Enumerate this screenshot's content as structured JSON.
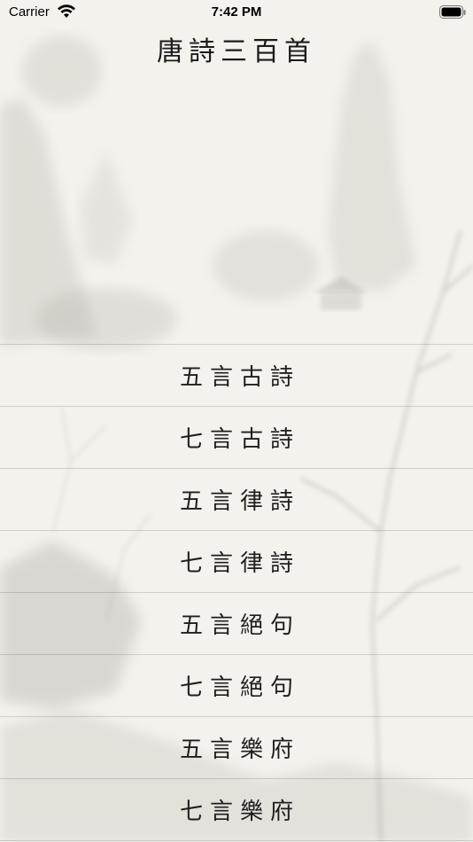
{
  "status_bar": {
    "carrier": "Carrier",
    "time": "7:42 PM",
    "wifi_icon": "wifi-icon",
    "battery_icon": "battery-icon"
  },
  "header": {
    "title": "唐詩三百首"
  },
  "menu": {
    "items": [
      {
        "label": "五言古詩"
      },
      {
        "label": "七言古詩"
      },
      {
        "label": "五言律詩"
      },
      {
        "label": "七言律詩"
      },
      {
        "label": "五言絕句"
      },
      {
        "label": "七言絕句"
      },
      {
        "label": "五言樂府"
      },
      {
        "label": "七言樂府"
      }
    ]
  },
  "colors": {
    "background": "#f4f2ec",
    "text": "#1e1e1e",
    "divider": "#d6d4cf"
  }
}
